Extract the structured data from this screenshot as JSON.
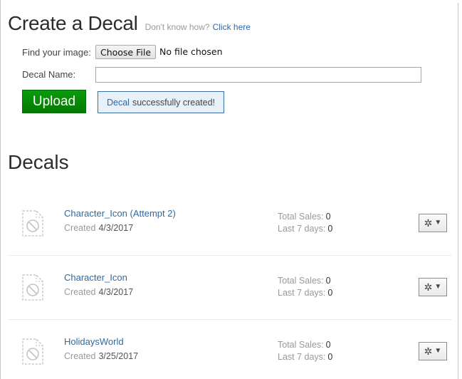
{
  "create": {
    "title": "Create a Decal",
    "help_text": "Don't know how?",
    "help_link": "Click here",
    "find_image_label": "Find your image:",
    "choose_file_label": "Choose File",
    "no_file_text": "No file chosen",
    "decal_name_label": "Decal Name:",
    "decal_name_value": "",
    "decal_name_placeholder": "",
    "upload_label": "Upload",
    "success_message": {
      "link_text": "Decal",
      "text": "successfully created!"
    }
  },
  "decals": {
    "title": "Decals",
    "total_sales_label": "Total Sales:",
    "last7_label": "Last 7 days:",
    "created_label": "Created",
    "items": [
      {
        "name": "Character_Icon (Attempt 2)",
        "created": "4/3/2017",
        "total_sales": "0",
        "last_7_days": "0"
      },
      {
        "name": "Character_Icon",
        "created": "4/3/2017",
        "total_sales": "0",
        "last_7_days": "0"
      },
      {
        "name": "HolidaysWorld",
        "created": "3/25/2017",
        "total_sales": "0",
        "last_7_days": "0"
      }
    ],
    "row_icons": {
      "thumbnail": "unavailable-image-icon",
      "menu": "gear-icon",
      "menu_caret": "caret-down-icon"
    }
  },
  "colors": {
    "link": "#2a6aa8",
    "upload_green": "#028a02",
    "message_bg": "#e7f0fb",
    "message_border": "#3d6ea3"
  }
}
